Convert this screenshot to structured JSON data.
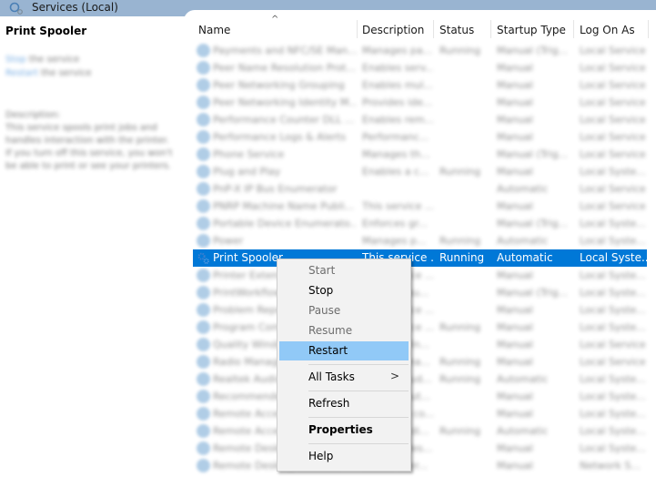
{
  "window": {
    "title": "Services (Local)"
  },
  "left_pane": {
    "service_title": "Print Spooler",
    "actions": [
      {
        "link": "Stop",
        "text": " the service"
      },
      {
        "link": "Restart",
        "text": " the service"
      }
    ],
    "description_label": "Description:",
    "description_lines": [
      "This service spools print jobs and",
      "handles interaction with the printer.",
      "If you turn off this service, you won't",
      "be able to print or see your printers."
    ]
  },
  "table": {
    "sort_indicator": "^",
    "columns": [
      "Name",
      "Description",
      "Status",
      "Startup Type",
      "Log On As"
    ],
    "rows": [
      {
        "name": "Payments and NFC/SE Man...",
        "desc": "Manages pa...",
        "status": "Running",
        "startup": "Manual (Trig...",
        "logon": "Local Service"
      },
      {
        "name": "Peer Name Resolution Prot...",
        "desc": "Enables serv...",
        "status": "",
        "startup": "Manual",
        "logon": "Local Service"
      },
      {
        "name": "Peer Networking Grouping",
        "desc": "Enables mul...",
        "status": "",
        "startup": "Manual",
        "logon": "Local Service"
      },
      {
        "name": "Peer Networking Identity M...",
        "desc": "Provides ide...",
        "status": "",
        "startup": "Manual",
        "logon": "Local Service"
      },
      {
        "name": "Performance Counter DLL ...",
        "desc": "Enables rem...",
        "status": "",
        "startup": "Manual",
        "logon": "Local Service"
      },
      {
        "name": "Performance Logs & Alerts",
        "desc": "Performanc...",
        "status": "",
        "startup": "Manual",
        "logon": "Local Service"
      },
      {
        "name": "Phone Service",
        "desc": "Manages th...",
        "status": "",
        "startup": "Manual (Trig...",
        "logon": "Local Service"
      },
      {
        "name": "Plug and Play",
        "desc": "Enables a c...",
        "status": "Running",
        "startup": "Manual",
        "logon": "Local Syste..."
      },
      {
        "name": "PnP-X IP Bus Enumerator",
        "desc": "",
        "status": "",
        "startup": "Automatic",
        "logon": "Local Service"
      },
      {
        "name": "PNRP Machine Name Publi...",
        "desc": "This service ...",
        "status": "",
        "startup": "Manual",
        "logon": "Local Service"
      },
      {
        "name": "Portable Device Enumerato...",
        "desc": "Enforces gr...",
        "status": "",
        "startup": "Manual (Trig...",
        "logon": "Local Syste..."
      },
      {
        "name": "Power",
        "desc": "Manages p...",
        "status": "Running",
        "startup": "Automatic",
        "logon": "Local Syste..."
      },
      {
        "name": "Print Spooler",
        "desc": "This service ...",
        "status": "Running",
        "startup": "Automatic",
        "logon": "Local Syste...",
        "selected": true
      },
      {
        "name": "Printer Extensions and No...",
        "desc": "This service ...",
        "status": "",
        "startup": "Manual",
        "logon": "Local Syste..."
      },
      {
        "name": "PrintWorkflow",
        "desc": "Provides su...",
        "status": "",
        "startup": "Manual (Trig...",
        "logon": "Local Syste..."
      },
      {
        "name": "Problem Reports Control P...",
        "desc": "This service ...",
        "status": "",
        "startup": "Manual",
        "logon": "Local Syste..."
      },
      {
        "name": "Program Compatibility Assi...",
        "desc": "This service ...",
        "status": "Running",
        "startup": "Manual",
        "logon": "Local Syste..."
      },
      {
        "name": "Quality Windows Audio Vid...",
        "desc": "Quality Win...",
        "status": "",
        "startup": "Manual",
        "logon": "Local Service"
      },
      {
        "name": "Radio Management Service",
        "desc": "Radio Mana...",
        "status": "Running",
        "startup": "Manual",
        "logon": "Local Service"
      },
      {
        "name": "Realtek Audio Universal Se...",
        "desc": "Realtek Aud...",
        "status": "Running",
        "startup": "Automatic",
        "logon": "Local Syste..."
      },
      {
        "name": "Recommended Troublesho...",
        "desc": "Enables aut...",
        "status": "",
        "startup": "Manual",
        "logon": "Local Syste..."
      },
      {
        "name": "Remote Access Auto Conne...",
        "desc": "Creates a co...",
        "status": "",
        "startup": "Manual",
        "logon": "Local Syste..."
      },
      {
        "name": "Remote Access Connection...",
        "desc": "Manages di...",
        "status": "Running",
        "startup": "Automatic",
        "logon": "Local Syste..."
      },
      {
        "name": "Remote Desktop Configurat...",
        "desc": "Remote Des...",
        "status": "",
        "startup": "Manual",
        "logon": "Local Syste..."
      },
      {
        "name": "Remote Desktop Services",
        "desc": "Allows user...",
        "status": "",
        "startup": "Manual",
        "logon": "Network S..."
      }
    ]
  },
  "context_menu": {
    "items": [
      {
        "label": "Start",
        "disabled": true
      },
      {
        "label": "Stop"
      },
      {
        "label": "Pause",
        "disabled": true
      },
      {
        "label": "Resume",
        "disabled": true
      },
      {
        "label": "Restart",
        "hover": true
      },
      {
        "separator": true
      },
      {
        "label": "All Tasks",
        "submenu": true,
        "arrow": ">"
      },
      {
        "separator": true
      },
      {
        "label": "Refresh"
      },
      {
        "separator": true
      },
      {
        "label": "Properties",
        "bold": true
      },
      {
        "separator": true
      },
      {
        "label": "Help"
      }
    ]
  },
  "colors": {
    "titlebar": "#99b4d1",
    "selection": "#0078d7",
    "menu_hover": "#91c9f7",
    "menu_bg": "#f2f2f2",
    "link": "#0066cc"
  }
}
